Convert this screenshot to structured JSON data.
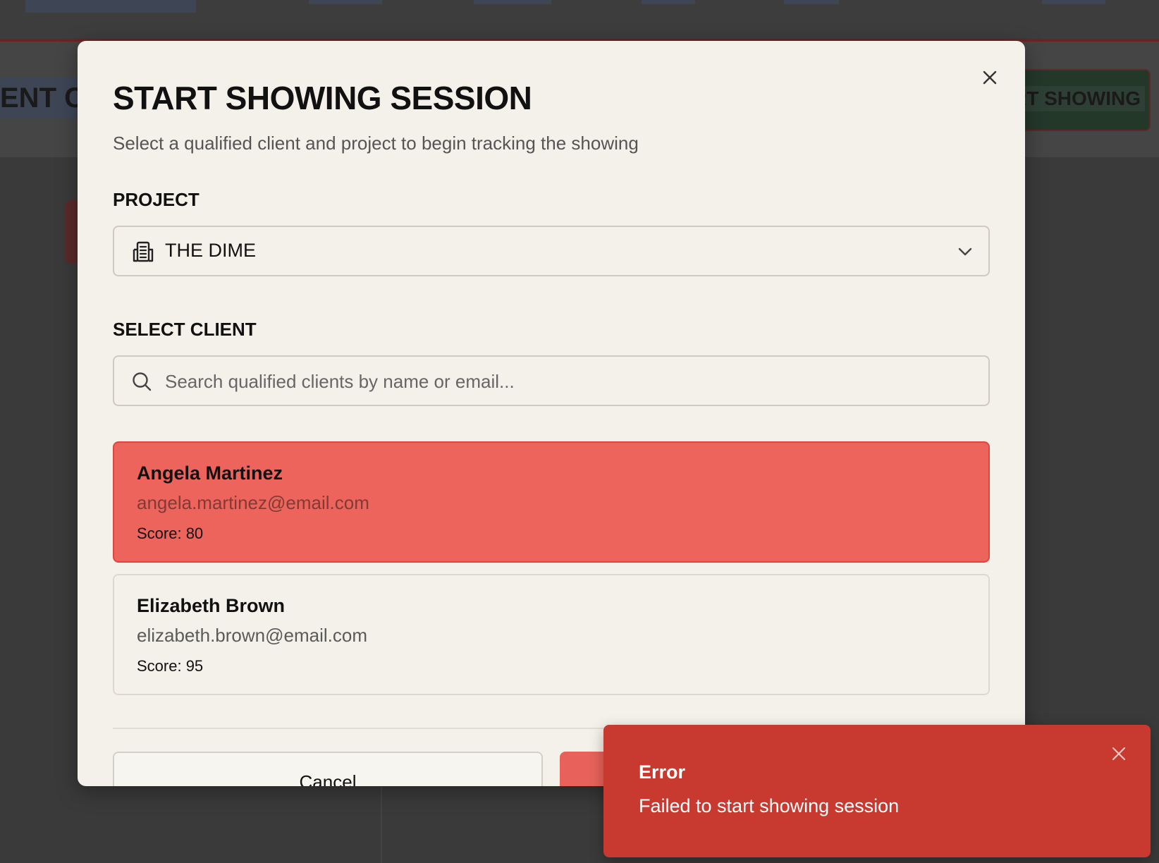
{
  "background": {
    "page_title_partial": "ENT CO",
    "start_button_partial": "RT SHOWING"
  },
  "modal": {
    "title": "START SHOWING SESSION",
    "subtitle": "Select a qualified client and project to begin tracking the showing",
    "project": {
      "label": "PROJECT",
      "selected_value": "THE DIME",
      "icon": "building-icon"
    },
    "client_section": {
      "label": "SELECT CLIENT",
      "search_placeholder": "Search qualified clients by name or email...",
      "search_value": ""
    },
    "clients": [
      {
        "name": "Angela Martinez",
        "email": "angela.martinez@email.com",
        "score": "Score: 80",
        "selected": true
      },
      {
        "name": "Elizabeth Brown",
        "email": "elizabeth.brown@email.com",
        "score": "Score: 95",
        "selected": false
      }
    ],
    "actions": {
      "cancel_label": "Cancel"
    }
  },
  "toast": {
    "title": "Error",
    "message": "Failed to start showing session"
  },
  "colors": {
    "selected_card": "#ec645c",
    "toast_bg": "#c8392f",
    "modal_bg": "#f4f1ea"
  }
}
